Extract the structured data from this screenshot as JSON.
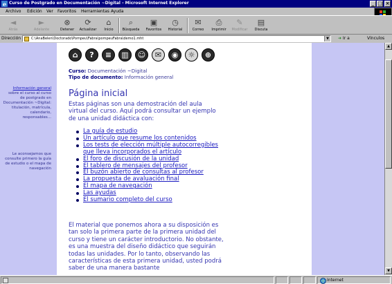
{
  "window": {
    "title": "Curso de Postgrado en Documentación ~Digital - Microsoft Internet Explorer"
  },
  "menu": [
    "Archivo",
    "Edición",
    "Ver",
    "Favoritos",
    "Herramientas",
    "Ayuda"
  ],
  "toolbar": {
    "back": "Atrás",
    "forward": "Adelante",
    "stop": "Detener",
    "refresh": "Actualizar",
    "home": "Inicio",
    "search": "Búsqueda",
    "favorites": "Favoritos",
    "history": "Historial",
    "mail": "Correo",
    "print": "Imprimir",
    "edit": "Modificar",
    "discuss": "Discuta"
  },
  "address": {
    "label": "Dirección",
    "url": "C:\\AnaBelen\\Doctorado\\Pompeu\\Fabra\\pompeuFabra\\demo1.mht",
    "go": "Ir a",
    "links": "Vínculos"
  },
  "page": {
    "course_label": "Curso:",
    "course_value": "Documentación ~Digital",
    "doctype_label": "Tipo de documento:",
    "doctype_value": "Información general",
    "heading": "Página inicial",
    "intro": "Estas páginas son una demostración del aula virtual del curso. Aquí podrá consultar un ejemplo de una unidad didáctica con:",
    "links": [
      "La guía de estudio",
      "Un artículo que resume los contenidos",
      "Los tests de elección múltiple autocorregibles que lleva incorporados el artículo",
      "El foro de discusión de la unidad",
      "El tablero de mensajes del profesor",
      "El buzón abierto de consultas al profesor",
      "La propuesta de avaluación final",
      "El mapa de navegación",
      "Las ayudas",
      "El sumario completo del curso"
    ],
    "paragraph": "El material que ponemos ahora a su disposición es tan solo la primera parte de la primera unidad del curso y tiene un carácter introductorio. No obstante, es una muestra del diseño didáctico que seguirán todas las unidades. Por lo tanto, observando las características de esta primera unidad, usted podrá saber de una manera bastante"
  },
  "sidebar": {
    "info_link": "Información general",
    "info_text": "sobre el curso al curso de postgrado en Documentación ~Digital: titulación, matrícula, calendario, responsables...",
    "advice_text": "Le aconsejamos que consulte primero la guía de estudio o el mapa de navegación"
  },
  "status": {
    "zone": "Internet"
  }
}
